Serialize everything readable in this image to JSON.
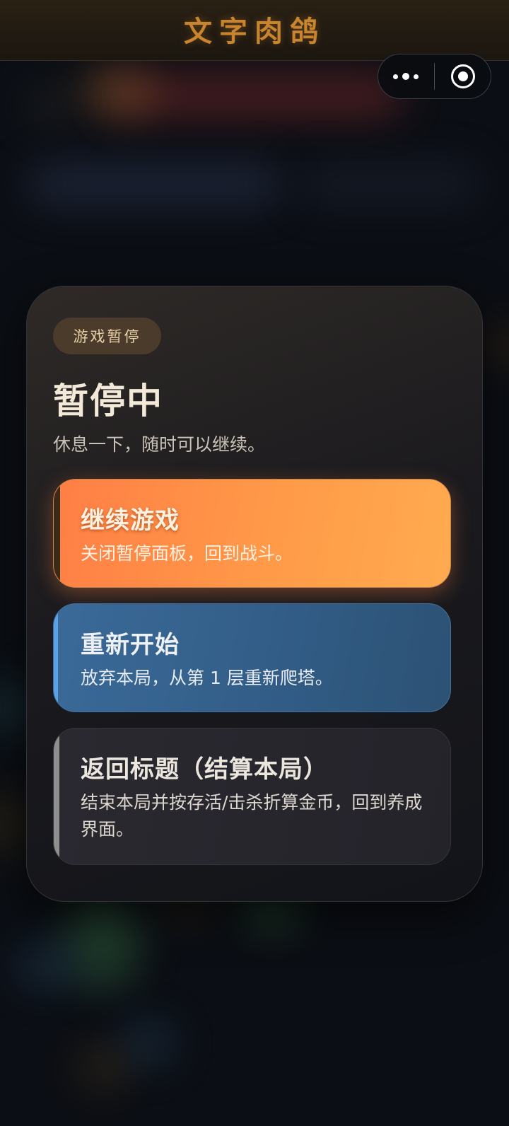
{
  "app": {
    "title": "文字肉鸽"
  },
  "capsule": {
    "more_icon": "more-dots-icon",
    "close_icon": "target-circle-icon"
  },
  "panel": {
    "badge": "游戏暂停",
    "title": "暂停中",
    "subtitle": "休息一下，随时可以继续。",
    "options": [
      {
        "title": "继续游戏",
        "desc": "关闭暂停面板，回到战斗。",
        "accent": "#ff8a45"
      },
      {
        "title": "重新开始",
        "desc": "放弃本局，从第 1 层重新爬塔。",
        "accent": "#3b6a99"
      },
      {
        "title": "返回标题（结算本局）",
        "desc": "结束本局并按存活/击杀折算金币，回到养成界面。",
        "accent": "#2a2930"
      }
    ]
  },
  "colors": {
    "title_gold": "#c8842f",
    "background": "#0b0e14"
  }
}
